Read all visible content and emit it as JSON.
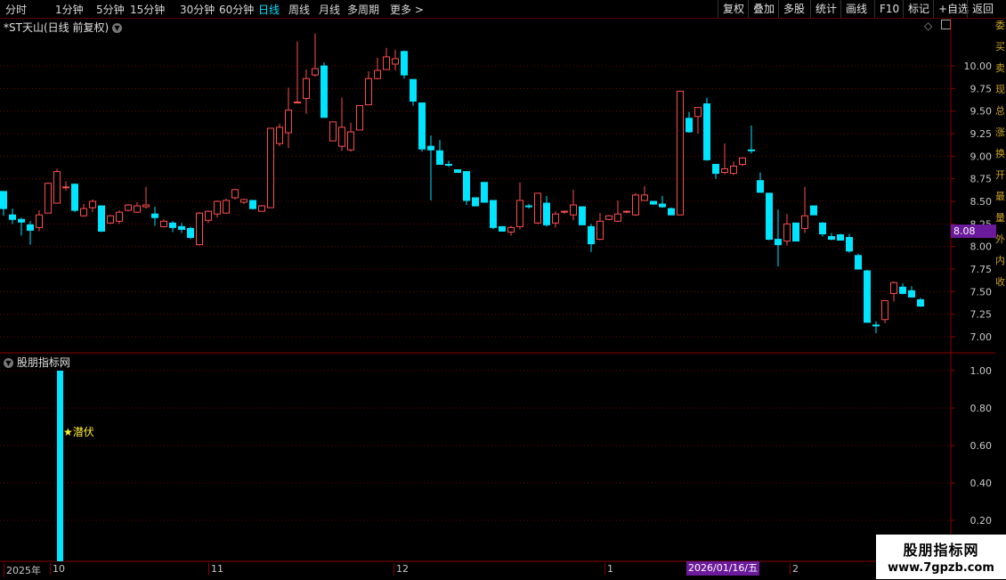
{
  "toolbar": {
    "left": [
      {
        "label": "分时",
        "active": false
      },
      {
        "label": "1分钟",
        "active": false
      },
      {
        "label": "5分钟",
        "active": false
      },
      {
        "label": "15分钟",
        "active": false
      },
      {
        "label": "30分钟",
        "active": false
      },
      {
        "label": "60分钟",
        "active": false
      },
      {
        "label": "日线",
        "active": true
      },
      {
        "label": "周线",
        "active": false
      },
      {
        "label": "月线",
        "active": false
      },
      {
        "label": "多周期",
        "active": false
      },
      {
        "label": "更多 >",
        "active": false
      }
    ],
    "right": [
      "复权",
      "叠加",
      "多股",
      "统计",
      "画线",
      "F10",
      "标记",
      "+自选",
      "返回"
    ]
  },
  "main_panel": {
    "title": "*ST天山(日线 前复权)",
    "price_label": "8.08"
  },
  "indicator_panel": {
    "title": "股朋指标网",
    "signal_label": "★潜伏"
  },
  "date_axis": {
    "labels": [
      "2025年",
      "10",
      "11",
      "12",
      "1",
      "2"
    ],
    "cursor_date": "2026/01/16/五"
  },
  "watermark": {
    "line1": "股朋指标网",
    "line2": "www.7gpzb.com"
  },
  "side_strip": [
    "委",
    "买",
    "卖",
    "现",
    "总",
    "涨",
    "换",
    "开",
    "最",
    "量",
    "外",
    "内",
    "收"
  ],
  "colors": {
    "up": "#ff4d4d",
    "down": "#00e5ff",
    "grid": "#8b0000",
    "axis_text": "#c8c8c8"
  },
  "chart_data": [
    {
      "type": "candlestick",
      "title": "*ST天山(日线 前复权)",
      "ylim": [
        6.9,
        10.6
      ],
      "yticks": [
        7.0,
        7.25,
        7.5,
        7.75,
        8.0,
        8.25,
        8.5,
        8.75,
        9.0,
        9.25,
        9.5,
        9.75,
        10.0
      ],
      "ohlc": [
        [
          8.61,
          8.61,
          8.34,
          8.42
        ],
        [
          8.35,
          8.42,
          8.25,
          8.3
        ],
        [
          8.3,
          8.32,
          8.12,
          8.27
        ],
        [
          8.24,
          8.28,
          8.02,
          8.18
        ],
        [
          8.21,
          8.4,
          8.17,
          8.35
        ],
        [
          8.37,
          8.71,
          8.37,
          8.7
        ],
        [
          8.48,
          8.86,
          8.48,
          8.83
        ],
        [
          8.65,
          8.72,
          8.62,
          8.66
        ],
        [
          8.69,
          8.7,
          8.38,
          8.4
        ],
        [
          8.34,
          8.47,
          8.33,
          8.42
        ],
        [
          8.43,
          8.52,
          8.38,
          8.5
        ],
        [
          8.45,
          8.45,
          8.16,
          8.17
        ],
        [
          8.26,
          8.35,
          8.25,
          8.34
        ],
        [
          8.28,
          8.4,
          8.25,
          8.38
        ],
        [
          8.4,
          8.47,
          8.39,
          8.46
        ],
        [
          8.38,
          8.49,
          8.37,
          8.45
        ],
        [
          8.44,
          8.66,
          8.42,
          8.46
        ],
        [
          8.36,
          8.44,
          8.23,
          8.32
        ],
        [
          8.22,
          8.3,
          8.21,
          8.28
        ],
        [
          8.26,
          8.28,
          8.16,
          8.21
        ],
        [
          8.22,
          8.26,
          8.15,
          8.19
        ],
        [
          8.2,
          8.22,
          8.08,
          8.1
        ],
        [
          8.02,
          8.38,
          8.01,
          8.37
        ],
        [
          8.29,
          8.4,
          8.26,
          8.39
        ],
        [
          8.36,
          8.51,
          8.32,
          8.5
        ],
        [
          8.37,
          8.53,
          8.36,
          8.51
        ],
        [
          8.54,
          8.64,
          8.52,
          8.63
        ],
        [
          8.49,
          8.53,
          8.47,
          8.52
        ],
        [
          8.51,
          8.51,
          8.41,
          8.42
        ],
        [
          8.39,
          8.46,
          8.39,
          8.45
        ],
        [
          8.43,
          9.31,
          8.43,
          9.31
        ],
        [
          9.14,
          9.36,
          9.11,
          9.32
        ],
        [
          9.26,
          9.76,
          9.09,
          9.51
        ],
        [
          9.59,
          10.27,
          9.59,
          9.6
        ],
        [
          9.64,
          9.96,
          9.47,
          9.86
        ],
        [
          9.9,
          10.36,
          9.88,
          9.97
        ],
        [
          10.0,
          10.04,
          9.43,
          9.43
        ],
        [
          9.17,
          9.38,
          9.17,
          9.38
        ],
        [
          9.11,
          9.65,
          9.06,
          9.32
        ],
        [
          9.07,
          9.37,
          9.05,
          9.27
        ],
        [
          9.29,
          9.56,
          9.29,
          9.56
        ],
        [
          9.57,
          9.94,
          9.57,
          9.86
        ],
        [
          9.86,
          10.09,
          9.85,
          9.95
        ],
        [
          9.96,
          10.2,
          9.96,
          10.1
        ],
        [
          10.02,
          10.18,
          9.95,
          10.08
        ],
        [
          10.16,
          10.17,
          9.86,
          9.9
        ],
        [
          9.85,
          9.85,
          9.56,
          9.61
        ],
        [
          9.59,
          9.59,
          9.05,
          9.08
        ],
        [
          9.11,
          9.23,
          8.51,
          9.07
        ],
        [
          9.06,
          9.18,
          8.91,
          8.91
        ],
        [
          8.91,
          8.95,
          8.88,
          8.9
        ],
        [
          8.85,
          8.85,
          8.82,
          8.82
        ],
        [
          8.83,
          8.83,
          8.46,
          8.51
        ],
        [
          8.54,
          8.53,
          8.45,
          8.45
        ],
        [
          8.71,
          8.71,
          8.49,
          8.49
        ],
        [
          8.51,
          8.51,
          8.19,
          8.21
        ],
        [
          8.22,
          8.22,
          8.17,
          8.17
        ],
        [
          8.16,
          8.23,
          8.12,
          8.21
        ],
        [
          8.22,
          8.71,
          8.19,
          8.51
        ],
        [
          8.45,
          8.47,
          8.42,
          8.44
        ],
        [
          8.26,
          8.59,
          8.25,
          8.59
        ],
        [
          8.48,
          8.56,
          8.22,
          8.24
        ],
        [
          8.26,
          8.39,
          8.21,
          8.36
        ],
        [
          8.38,
          8.4,
          8.36,
          8.39
        ],
        [
          8.35,
          8.63,
          8.29,
          8.46
        ],
        [
          8.44,
          8.44,
          8.24,
          8.24
        ],
        [
          8.22,
          8.25,
          7.94,
          8.03
        ],
        [
          8.08,
          8.37,
          8.07,
          8.28
        ],
        [
          8.3,
          8.35,
          8.29,
          8.34
        ],
        [
          8.28,
          8.51,
          8.27,
          8.36
        ],
        [
          8.38,
          8.4,
          8.37,
          8.39
        ],
        [
          8.35,
          8.59,
          8.34,
          8.57
        ],
        [
          8.51,
          8.67,
          8.51,
          8.57
        ],
        [
          8.5,
          8.5,
          8.46,
          8.47
        ],
        [
          8.47,
          8.56,
          8.43,
          8.44
        ],
        [
          8.42,
          8.43,
          8.35,
          8.35
        ],
        [
          8.35,
          9.72,
          8.35,
          9.72
        ],
        [
          9.42,
          9.49,
          9.26,
          9.27
        ],
        [
          9.44,
          9.54,
          9.25,
          9.54
        ],
        [
          9.58,
          9.65,
          8.95,
          8.96
        ],
        [
          8.91,
          8.91,
          8.75,
          8.81
        ],
        [
          8.82,
          9.14,
          8.8,
          8.86
        ],
        [
          8.81,
          8.94,
          8.79,
          8.89
        ],
        [
          8.91,
          8.99,
          8.89,
          8.98
        ],
        [
          9.07,
          9.34,
          9.03,
          9.06
        ],
        [
          8.73,
          8.82,
          8.61,
          8.6
        ],
        [
          8.59,
          8.59,
          8.07,
          8.08
        ],
        [
          8.08,
          8.41,
          7.78,
          8.02
        ],
        [
          8.06,
          8.36,
          8.01,
          8.25
        ],
        [
          8.26,
          8.18,
          8.06,
          8.06
        ],
        [
          8.2,
          8.66,
          8.15,
          8.34
        ],
        [
          8.45,
          8.45,
          8.35,
          8.35
        ],
        [
          8.26,
          8.27,
          8.11,
          8.14
        ],
        [
          8.11,
          8.15,
          8.07,
          8.08
        ],
        [
          8.13,
          8.14,
          8.07,
          8.07
        ],
        [
          8.1,
          8.14,
          7.93,
          7.95
        ],
        [
          7.9,
          7.92,
          7.75,
          7.75
        ],
        [
          7.73,
          7.74,
          7.16,
          7.16
        ],
        [
          7.13,
          7.17,
          7.04,
          7.12
        ],
        [
          7.19,
          7.41,
          7.15,
          7.4
        ],
        [
          7.48,
          7.61,
          7.39,
          7.6
        ],
        [
          7.55,
          7.59,
          7.47,
          7.48
        ],
        [
          7.51,
          7.56,
          7.44,
          7.44
        ],
        [
          7.41,
          7.43,
          7.33,
          7.34
        ]
      ]
    },
    {
      "type": "bar",
      "title": "股朋指标网",
      "ylim": [
        0,
        1.05
      ],
      "yticks": [
        0.2,
        0.4,
        0.6,
        0.8,
        1.0
      ],
      "bars": [
        {
          "index": 6,
          "value": 1.0
        }
      ]
    }
  ]
}
